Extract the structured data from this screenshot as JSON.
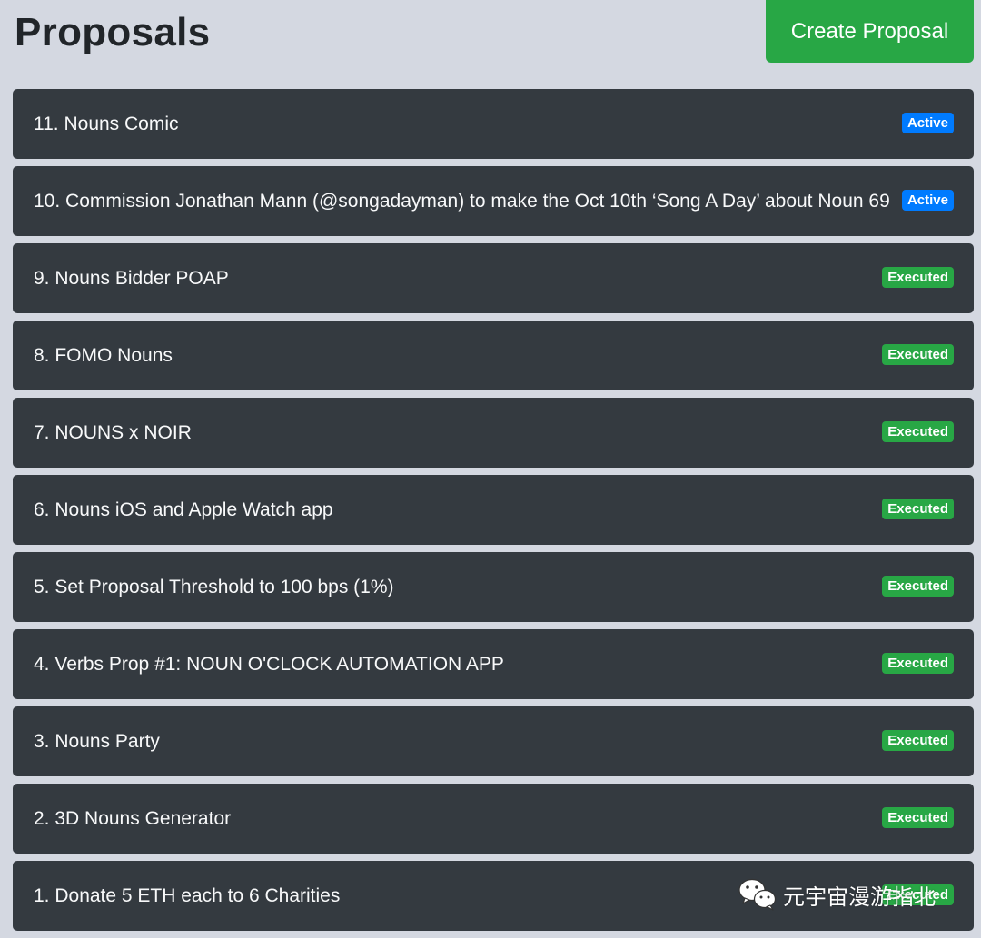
{
  "header": {
    "title": "Proposals",
    "create_button_label": "Create Proposal"
  },
  "colors": {
    "page_background": "#d4d8e1",
    "row_background": "#343a40",
    "active_badge": "#007bff",
    "executed_badge": "#28a745",
    "create_button": "#28a745"
  },
  "proposals": [
    {
      "title": "11. Nouns Comic",
      "status": "Active",
      "status_kind": "active"
    },
    {
      "title": "10. Commission Jonathan Mann (@songadayman) to make the Oct 10th ‘Song A Day’ about Noun 69",
      "status": "Active",
      "status_kind": "active"
    },
    {
      "title": "9. Nouns Bidder POAP",
      "status": "Executed",
      "status_kind": "executed"
    },
    {
      "title": "8. FOMO Nouns",
      "status": "Executed",
      "status_kind": "executed"
    },
    {
      "title": "7. NOUNS x NOIR",
      "status": "Executed",
      "status_kind": "executed"
    },
    {
      "title": "6. Nouns iOS and Apple Watch app",
      "status": "Executed",
      "status_kind": "executed"
    },
    {
      "title": "5. Set Proposal Threshold to 100 bps (1%)",
      "status": "Executed",
      "status_kind": "executed"
    },
    {
      "title": "4. Verbs Prop #1: NOUN O'CLOCK AUTOMATION APP",
      "status": "Executed",
      "status_kind": "executed"
    },
    {
      "title": "3. Nouns Party",
      "status": "Executed",
      "status_kind": "executed"
    },
    {
      "title": "2. 3D Nouns Generator",
      "status": "Executed",
      "status_kind": "executed"
    },
    {
      "title": "1. Donate 5 ETH each to 6 Charities",
      "status": "Executed",
      "status_kind": "executed"
    }
  ],
  "watermark": {
    "icon": "wechat-icon",
    "text": "元宇宙漫游指北"
  }
}
